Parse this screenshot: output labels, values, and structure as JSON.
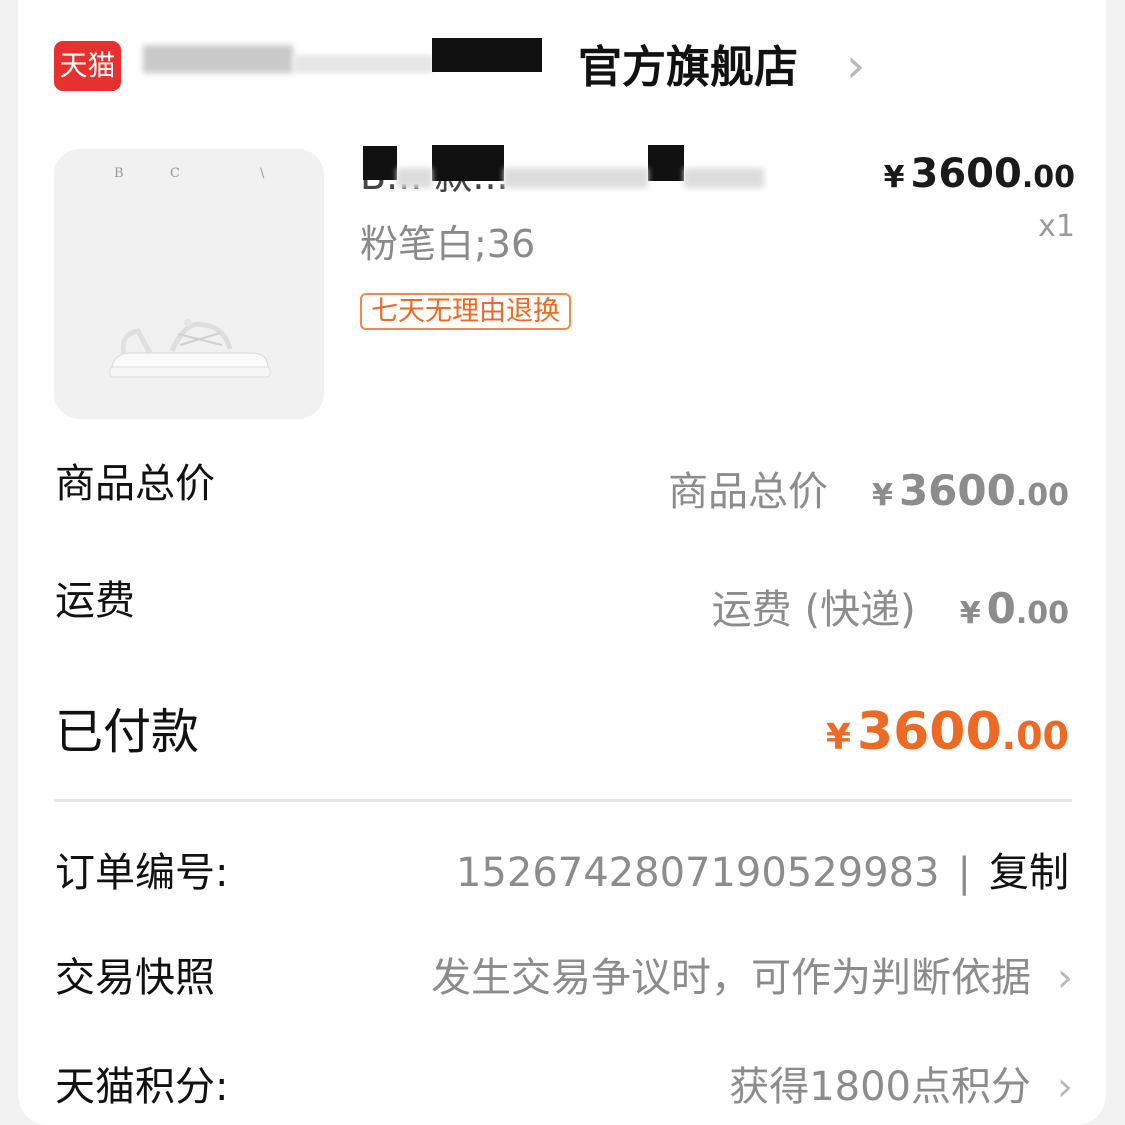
{
  "store": {
    "logo_text": "天猫",
    "name_suffix": "官方旗舰店"
  },
  "product": {
    "title_visible": "B... 款...",
    "variant": "粉笔白;36",
    "tag": "七天无理由退换",
    "price": {
      "currency": "¥",
      "integer": "3600",
      "decimal": ".00"
    },
    "quantity": "x1"
  },
  "summary": {
    "goods_total": {
      "label": "商品总价",
      "sub_label": "商品总价",
      "currency": "¥",
      "integer": "3600",
      "decimal": ".00"
    },
    "shipping": {
      "label": "运费",
      "sub_label": "运费 (快递)",
      "currency": "¥",
      "integer": "0",
      "decimal": ".00"
    },
    "paid": {
      "label": "已付款",
      "currency": "¥",
      "integer": "3600",
      "decimal": ".00"
    }
  },
  "order_info": {
    "order_no": {
      "label": "订单编号:",
      "value": "1526742807190529983",
      "separator": "|",
      "copy": "复制"
    },
    "snapshot": {
      "label": "交易快照",
      "value": "发生交易争议时，可作为判断依据"
    },
    "points": {
      "label": "天猫积分:",
      "value": "获得1800点积分"
    }
  },
  "colors": {
    "accent": "#ee6a24",
    "tmall_red": "#e6312f",
    "muted_text": "#8c8c8c"
  }
}
